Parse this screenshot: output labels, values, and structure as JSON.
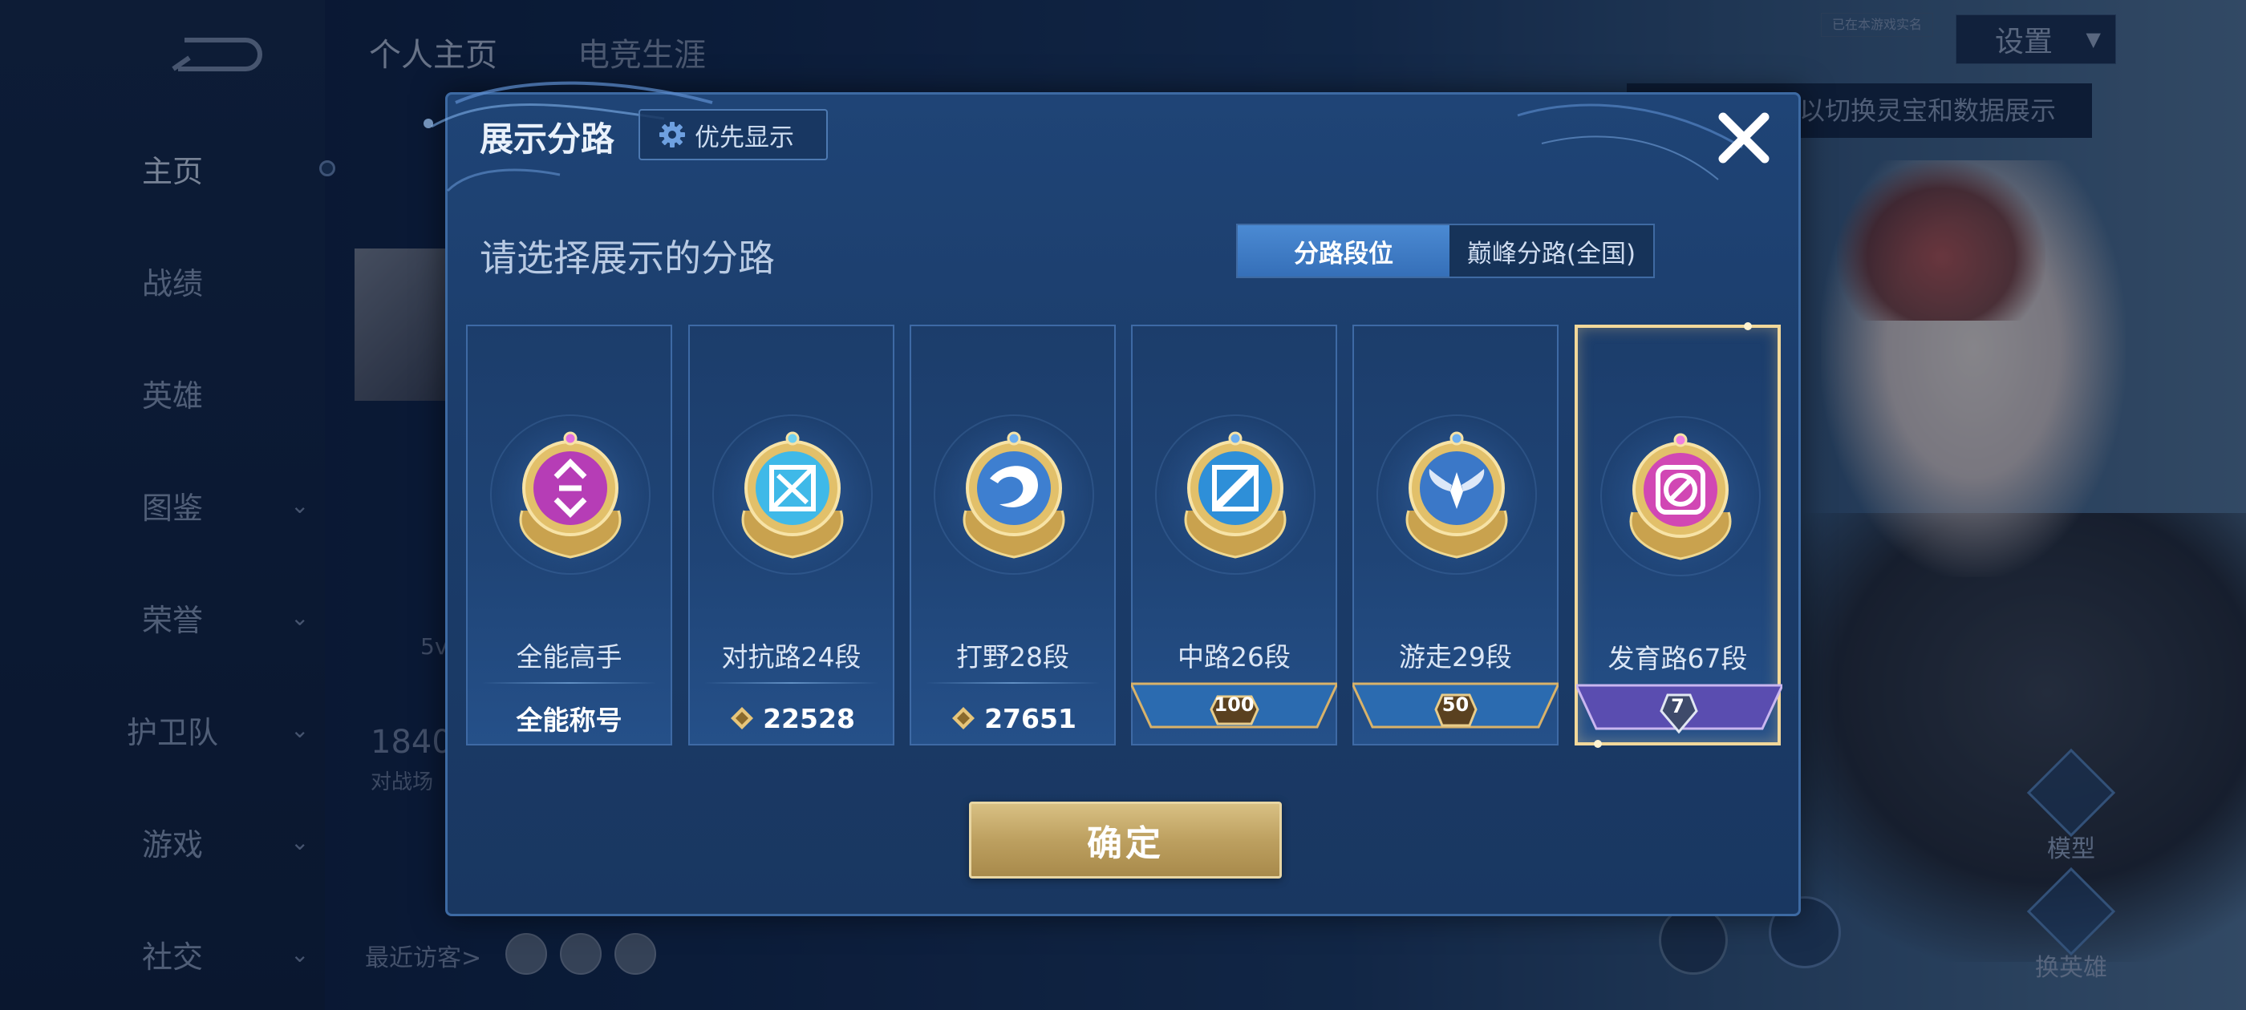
{
  "sidebar": {
    "items": [
      {
        "label": "主页",
        "active": true,
        "has_chevron": false
      },
      {
        "label": "战绩",
        "active": false,
        "has_chevron": false
      },
      {
        "label": "英雄",
        "active": false,
        "has_chevron": false
      },
      {
        "label": "图鉴",
        "active": false,
        "has_chevron": true
      },
      {
        "label": "荣誉",
        "active": false,
        "has_chevron": true
      },
      {
        "label": "护卫队",
        "active": false,
        "has_chevron": true
      },
      {
        "label": "游戏",
        "active": false,
        "has_chevron": true
      },
      {
        "label": "社交",
        "active": false,
        "has_chevron": true
      }
    ]
  },
  "header": {
    "tabs": [
      "个人主页",
      "电竞生涯"
    ],
    "settings_label": "设置",
    "tag_text": "已在本游戏实名",
    "hint_text": "以切换灵宝和数据展示"
  },
  "profile": {
    "stat_value": "1840",
    "stat_caption": "对战场",
    "mode_text": "5v",
    "visitors_label": "最近访客>"
  },
  "right_panel": {
    "model_label": "模型",
    "switch_hero_label": "换英雄"
  },
  "dialog": {
    "title": "展示分路",
    "priority_label": "优先显示",
    "prompt": "请选择展示的分路",
    "segment_tabs": [
      {
        "label": "分路段位",
        "active": true
      },
      {
        "label": "巅峰分路(全国)",
        "active": false
      }
    ],
    "cards": [
      {
        "name": "全能高手",
        "bottom_type": "text",
        "bottom_text": "全能称号",
        "medal": "all-round",
        "medal_color": "#b63db6",
        "selected": false
      },
      {
        "name": "对抗路24段",
        "bottom_type": "score",
        "bottom_text": "22528",
        "medal": "clash-lane",
        "medal_color": "#3fb9e8",
        "selected": false
      },
      {
        "name": "打野28段",
        "bottom_type": "score",
        "bottom_text": "27651",
        "medal": "jungle",
        "medal_color": "#3e7fd0",
        "selected": false
      },
      {
        "name": "中路26段",
        "bottom_type": "ribbon",
        "bottom_text": "100",
        "medal": "mid-lane",
        "medal_color": "#2e8fd8",
        "ribbon_color": "#2b6bb0",
        "selected": false
      },
      {
        "name": "游走29段",
        "bottom_type": "ribbon",
        "bottom_text": "50",
        "medal": "roam",
        "medal_color": "#3b78c8",
        "ribbon_color": "#2b6bb0",
        "selected": false
      },
      {
        "name": "发育路67段",
        "bottom_type": "ribbon",
        "bottom_text": "7",
        "medal": "farm-lane",
        "medal_color": "#d147b4",
        "ribbon_color": "#5a4db0",
        "selected": true
      }
    ],
    "confirm_label": "确定"
  },
  "colors": {
    "dialog_bg": "#1f4476",
    "accent_blue": "#4b8ad3",
    "confirm_gold": "#bda060",
    "selected_border": "#f2d89a"
  }
}
